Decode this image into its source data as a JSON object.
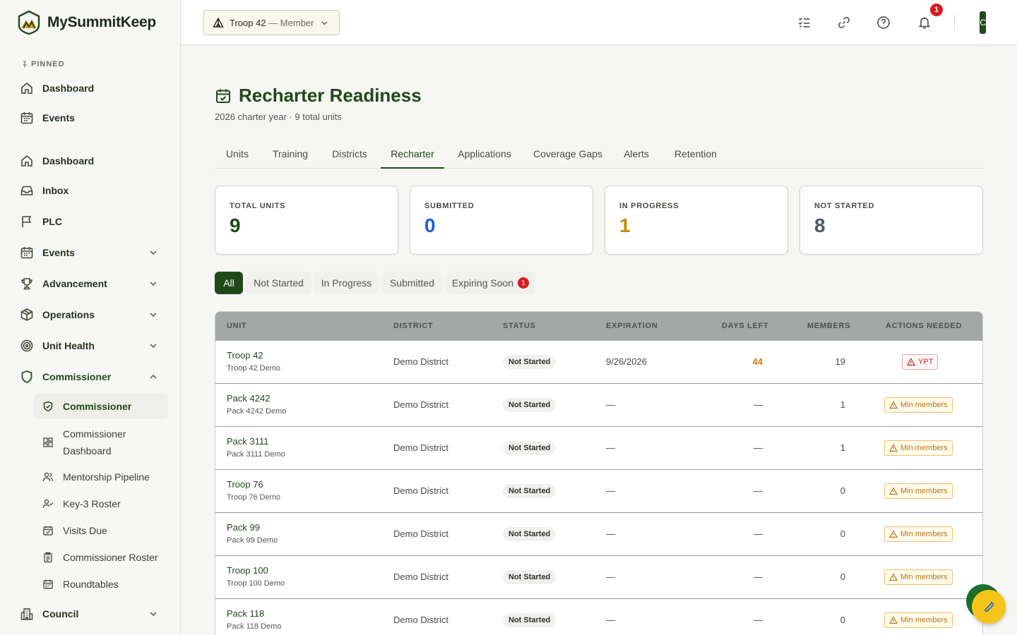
{
  "brand": {
    "name": "MySummitKeep"
  },
  "sidebar": {
    "pinned_label": "PINNED",
    "pinned": [
      {
        "label": "Dashboard",
        "icon": "home-icon"
      },
      {
        "label": "Events",
        "icon": "calendar-icon"
      }
    ],
    "items": [
      {
        "label": "Dashboard",
        "icon": "home-icon"
      },
      {
        "label": "Inbox",
        "icon": "inbox-icon"
      },
      {
        "label": "PLC",
        "icon": "flag-icon"
      },
      {
        "label": "Events",
        "icon": "calendar-icon"
      },
      {
        "label": "Advancement",
        "icon": "trophy-icon"
      },
      {
        "label": "Operations",
        "icon": "box-icon"
      },
      {
        "label": "Unit Health",
        "icon": "target-icon"
      },
      {
        "label": "Commissioner",
        "icon": "shield-icon"
      },
      {
        "label": "Council",
        "icon": "building-icon"
      }
    ],
    "commissioner_sub": [
      {
        "label": "Commissioner",
        "icon": "shield-check-icon"
      },
      {
        "label": "Commissioner Dashboard",
        "icon": "grid-icon"
      },
      {
        "label": "Mentorship Pipeline",
        "icon": "users-icon"
      },
      {
        "label": "Key-3 Roster",
        "icon": "user-check-icon"
      },
      {
        "label": "Visits Due",
        "icon": "calendar-check-icon"
      },
      {
        "label": "Commissioner Roster",
        "icon": "clipboard-icon"
      },
      {
        "label": "Roundtables",
        "icon": "calendar-icon"
      }
    ]
  },
  "topbar": {
    "unit_name": "Troop 42",
    "unit_role": "— Member",
    "notification_count": "1",
    "avatar_initial": "C"
  },
  "page": {
    "title": "Recharter Readiness",
    "subtitle": "2026 charter year · 9 total units",
    "tabs": [
      "Units",
      "Training",
      "Districts",
      "Recharter",
      "Applications",
      "Coverage Gaps",
      "Alerts",
      "Retention"
    ],
    "active_tab": "Recharter"
  },
  "stats": [
    {
      "label": "TOTAL UNITS",
      "value": "9",
      "color": "#1f4a18"
    },
    {
      "label": "SUBMITTED",
      "value": "0",
      "color": "#1f5fd0"
    },
    {
      "label": "IN PROGRESS",
      "value": "1",
      "color": "#c98a0a"
    },
    {
      "label": "NOT STARTED",
      "value": "8",
      "color": "#4d5a66"
    }
  ],
  "filters": [
    {
      "label": "All",
      "active": true
    },
    {
      "label": "Not Started"
    },
    {
      "label": "In Progress"
    },
    {
      "label": "Submitted"
    },
    {
      "label": "Expiring Soon",
      "badge": "1"
    }
  ],
  "table": {
    "headers": [
      "UNIT",
      "DISTRICT",
      "STATUS",
      "EXPIRATION",
      "DAYS LEFT",
      "MEMBERS",
      "ACTIONS NEEDED"
    ],
    "rows": [
      {
        "unit": "Troop 42",
        "sub": "Troop 42 Demo",
        "district": "Demo District",
        "status": "Not Started",
        "expiration": "9/26/2026",
        "days_left": "44",
        "members": "19",
        "action": "YPT",
        "action_type": "danger"
      },
      {
        "unit": "Pack 4242",
        "sub": "Pack 4242 Demo",
        "district": "Demo District",
        "status": "Not Started",
        "expiration": "—",
        "days_left": "—",
        "members": "1",
        "action": "Min members",
        "action_type": "warn"
      },
      {
        "unit": "Pack 3111",
        "sub": "Pack 3111 Demo",
        "district": "Demo District",
        "status": "Not Started",
        "expiration": "—",
        "days_left": "—",
        "members": "1",
        "action": "Min members",
        "action_type": "warn"
      },
      {
        "unit": "Troop 76",
        "sub": "Troop 76 Demo",
        "district": "Demo District",
        "status": "Not Started",
        "expiration": "—",
        "days_left": "—",
        "members": "0",
        "action": "Min members",
        "action_type": "warn"
      },
      {
        "unit": "Pack 99",
        "sub": "Pack 99 Demo",
        "district": "Demo District",
        "status": "Not Started",
        "expiration": "—",
        "days_left": "—",
        "members": "0",
        "action": "Min members",
        "action_type": "warn"
      },
      {
        "unit": "Troop 100",
        "sub": "Troop 100 Demo",
        "district": "Demo District",
        "status": "Not Started",
        "expiration": "—",
        "days_left": "—",
        "members": "0",
        "action": "Min members",
        "action_type": "warn"
      },
      {
        "unit": "Pack 118",
        "sub": "Pack 118 Demo",
        "district": "Demo District",
        "status": "Not Started",
        "expiration": "—",
        "days_left": "—",
        "members": "0",
        "action": "Min members",
        "action_type": "warn"
      }
    ]
  },
  "colors": {
    "brand": "#1f4a18",
    "danger": "#d81b21",
    "warn": "#b8741a",
    "days_left_accent": "#e07a12"
  }
}
